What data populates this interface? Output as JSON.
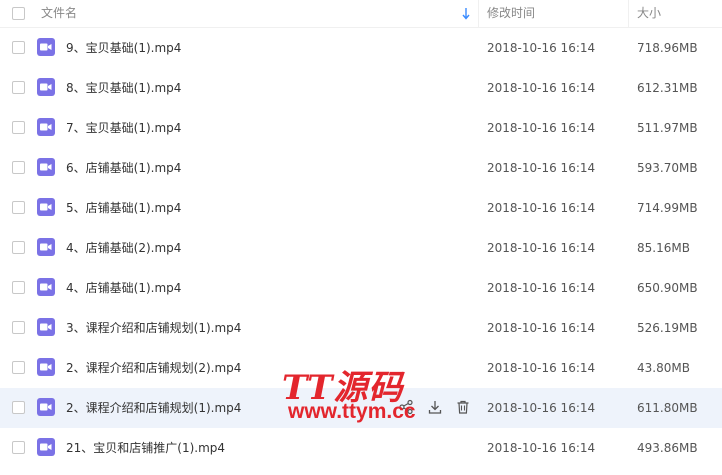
{
  "header": {
    "name_label": "文件名",
    "date_label": "修改时间",
    "size_label": "大小",
    "sort_icon": "sort-down-arrow-icon"
  },
  "files": [
    {
      "name": "9、宝贝基础(1).mp4",
      "date": "2018-10-16 16:14",
      "size": "718.96MB"
    },
    {
      "name": "8、宝贝基础(1).mp4",
      "date": "2018-10-16 16:14",
      "size": "612.31MB"
    },
    {
      "name": "7、宝贝基础(1).mp4",
      "date": "2018-10-16 16:14",
      "size": "511.97MB"
    },
    {
      "name": "6、店铺基础(1).mp4",
      "date": "2018-10-16 16:14",
      "size": "593.70MB"
    },
    {
      "name": "5、店铺基础(1).mp4",
      "date": "2018-10-16 16:14",
      "size": "714.99MB"
    },
    {
      "name": "4、店铺基础(2).mp4",
      "date": "2018-10-16 16:14",
      "size": "85.16MB"
    },
    {
      "name": "4、店铺基础(1).mp4",
      "date": "2018-10-16 16:14",
      "size": "650.90MB"
    },
    {
      "name": "3、课程介绍和店铺规划(1).mp4",
      "date": "2018-10-16 16:14",
      "size": "526.19MB"
    },
    {
      "name": "2、课程介绍和店铺规划(2).mp4",
      "date": "2018-10-16 16:14",
      "size": "43.80MB"
    },
    {
      "name": "2、课程介绍和店铺规划(1).mp4",
      "date": "2018-10-16 16:14",
      "size": "611.80MB"
    },
    {
      "name": "21、宝贝和店铺推广(1).mp4",
      "date": "2018-10-16 16:14",
      "size": "493.86MB"
    }
  ],
  "hovered_row": 9,
  "row_actions": [
    "share-icon",
    "download-icon",
    "delete-icon"
  ],
  "watermark": {
    "title": "TT源码",
    "url": "www.ttym.cc"
  },
  "colors": {
    "file_icon": "#7b72e6",
    "hover_row": "#eef3fb",
    "sort_arrow": "#3b8cff",
    "watermark": "#e3262d"
  }
}
